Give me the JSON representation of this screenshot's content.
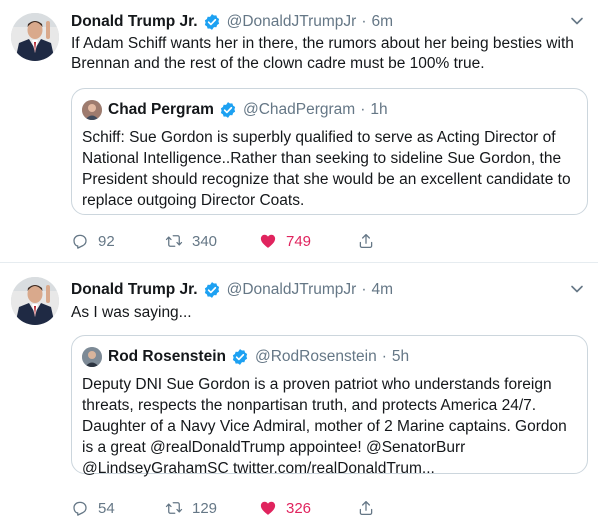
{
  "tweets": [
    {
      "author_name": "Donald Trump Jr.",
      "handle": "@DonaldJTrumpJr",
      "separator": "·",
      "time": "6m",
      "text": "If Adam Schiff wants her in there, the rumors about her being besties with Brennan and the rest of the clown cadre must be 100% true.",
      "quote": {
        "author_name": "Chad Pergram",
        "handle": "@ChadPergram",
        "separator": "·",
        "time": "1h",
        "text": "Schiff: Sue Gordon is superbly qualified to serve as Acting Director of National Intelligence..Rather than seeking to sideline Sue Gordon, the President should recognize that she would be an excellent candidate to replace outgoing Director Coats."
      },
      "replies": "92",
      "retweets": "340",
      "likes": "749"
    },
    {
      "author_name": "Donald Trump Jr.",
      "handle": "@DonaldJTrumpJr",
      "separator": "·",
      "time": "4m",
      "text": "As I was saying...",
      "quote": {
        "author_name": "Rod Rosenstein",
        "handle": "@RodRosenstein",
        "separator": "·",
        "time": "5h",
        "text": "Deputy DNI Sue Gordon is a proven patriot who understands foreign threats, respects the nonpartisan truth, and protects America 24/7. Daughter of a Navy Vice Admiral, mother of 2 Marine captains. Gordon is a great @realDonaldTrump appointee! @SenatorBurr @LindseyGrahamSC twitter.com/realDonaldTrum..."
      },
      "replies": "54",
      "retweets": "129",
      "likes": "326"
    }
  ],
  "colors": {
    "text": "#14171a",
    "muted": "#657786",
    "verified": "#1da1f2",
    "like": "#e0245e",
    "border": "#ccd6dd"
  },
  "icons": [
    "verified-badge-icon",
    "chevron-down-icon",
    "reply-icon",
    "retweet-icon",
    "heart-icon",
    "share-icon"
  ]
}
